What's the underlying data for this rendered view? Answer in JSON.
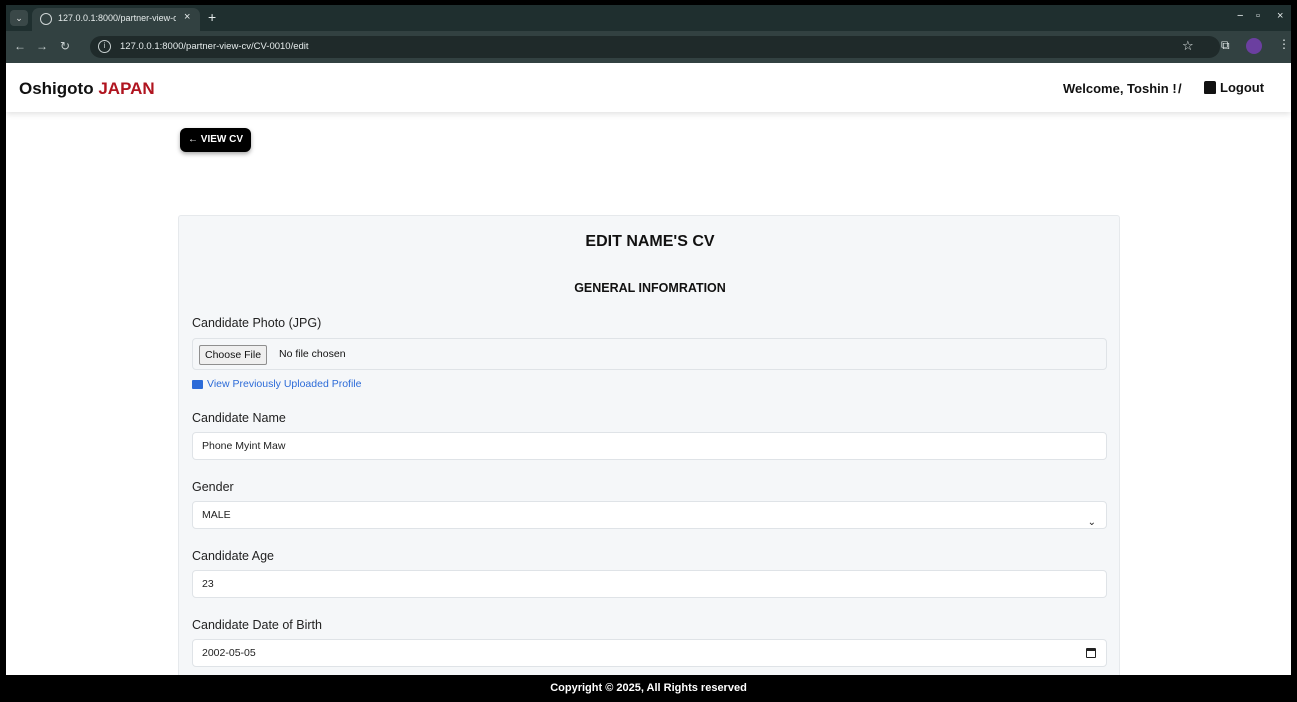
{
  "browser": {
    "tab_title": "127.0.0.1:8000/partner-view-cv",
    "tab_close": "×",
    "new_tab": "+",
    "url": "127.0.0.1:8000/partner-view-cv/CV-0010/edit",
    "minimize": "−",
    "restore": "▫",
    "close": "×"
  },
  "navbar": {
    "brand_main": "Oshigoto",
    "brand_accent": "JAPAN",
    "welcome": "Welcome, Toshin !",
    "separator": "/",
    "logout": "Logout"
  },
  "back_button": "← VIEW CV",
  "form": {
    "title": "EDIT NAME'S CV",
    "section_title": "GENERAL INFOMRATION",
    "photo_label": "Candidate Photo (JPG)",
    "file_button": "Choose File",
    "file_status": "No file chosen",
    "view_profile_link": "View Previously Uploaded Profile",
    "name_label": "Candidate Name",
    "name_value": "Phone Myint Maw",
    "gender_label": "Gender",
    "gender_value": "MALE",
    "age_label": "Candidate Age",
    "age_value": "23",
    "dob_label": "Candidate Date of Birth",
    "dob_value": "2002-05-05"
  },
  "footer": "Copyright © 2025, All Rights reserved",
  "colors": {
    "brand_accent": "#b0141f",
    "link": "#2c6bd8",
    "footer_bg": "#000000"
  }
}
